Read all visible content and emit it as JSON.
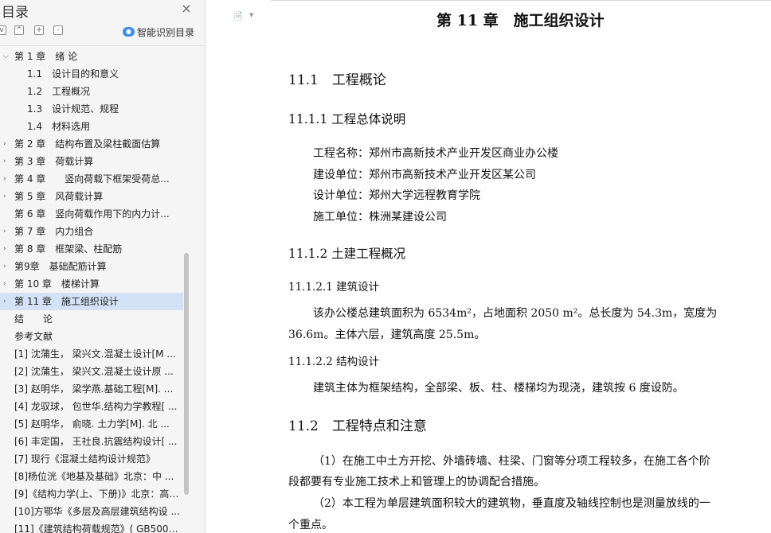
{
  "sidebar": {
    "title": "目录",
    "smart_toc_label": "智能识别目录",
    "tool_collapse": "-",
    "tool_up": "^",
    "tool_add": "+",
    "tool_check": "v",
    "close": "×",
    "items": [
      {
        "arrow": "v",
        "text": "第 1 章　绪  论",
        "level": 0
      },
      {
        "arrow": "",
        "text": "1.1　设计目的和意义",
        "level": 1
      },
      {
        "arrow": "",
        "text": "1.2　工程概况",
        "level": 1
      },
      {
        "arrow": "",
        "text": "1.3　设计规范、规程",
        "level": 1
      },
      {
        "arrow": "",
        "text": "1.4　材料选用",
        "level": 1
      },
      {
        "arrow": ">",
        "text": "第 2 章　结构布置及梁柱截面估算",
        "level": 0
      },
      {
        "arrow": ">",
        "text": "第 3 章　荷载计算",
        "level": 0
      },
      {
        "arrow": ">",
        "text": "第 4 章　　竖向荷载下框架受荷总...",
        "level": 0
      },
      {
        "arrow": ">",
        "text": "第 5 章　风荷载计算",
        "level": 0
      },
      {
        "arrow": "",
        "text": "第 6 章　竖向荷载作用下的内力计...",
        "level": 0
      },
      {
        "arrow": ">",
        "text": "第 7 章　内力组合",
        "level": 0
      },
      {
        "arrow": ">",
        "text": "第 8 章　框架梁、柱配筋",
        "level": 0
      },
      {
        "arrow": ">",
        "text": "第9章　基础配筋计算",
        "level": 0
      },
      {
        "arrow": ">",
        "text": "第 10 章　楼梯计算",
        "level": 0
      },
      {
        "arrow": ">",
        "text": "第 11 章　施工组织设计",
        "level": 0,
        "active": true
      },
      {
        "arrow": "",
        "text": "结　　论",
        "level": 0
      },
      {
        "arrow": "",
        "text": "参考文献",
        "level": 0
      },
      {
        "arrow": "",
        "text": "[1] 沈蒲生，  梁兴文.混凝土设计[M ...",
        "level": 0
      },
      {
        "arrow": "",
        "text": "[2] 沈蒲生，  梁兴文.混凝土设计原 ...",
        "level": 0
      },
      {
        "arrow": "",
        "text": "[3] 赵明华，  梁学燕.基础工程[M].  ...",
        "level": 0
      },
      {
        "arrow": "",
        "text": "[4] 龙驭球，  包世华.结构力学教程[ ...",
        "level": 0
      },
      {
        "arrow": "",
        "text": "[5] 赵明华，  俞晓. 土力学[M]. 北 ...",
        "level": 0
      },
      {
        "arrow": "",
        "text": "[6] 丰定国，  王社良.抗震结构设计[ ...",
        "level": 0
      },
      {
        "arrow": "",
        "text": "[7] 现行《混凝土结构设计规范》",
        "level": 0
      },
      {
        "arrow": "",
        "text": "[8]杨位洸《地基及基础》北京：中 ...",
        "level": 0
      },
      {
        "arrow": "",
        "text": "[9]《结构力学(上、下册)》北京：高 ...",
        "level": 0
      },
      {
        "arrow": "",
        "text": "[10]方鄂华《多层及高层建筑结构设 ...",
        "level": 0
      },
      {
        "arrow": "",
        "text": "[11]《建筑结构荷载规范》( GB500 ...",
        "level": 0
      }
    ]
  },
  "document": {
    "chapter_title": "第 11 章　施工组织设计",
    "s1": "11.1　工程概论",
    "s1_1": "11.1.1 工程总体说明",
    "info": [
      "工程名称：郑州市高新技术产业开发区商业办公楼",
      "建设单位：郑州市高新技术产业开发区某公司",
      "设计单位：郑州大学远程教育学院",
      "施工单位：株洲某建设公司"
    ],
    "s1_2": "11.1.2 土建工程概况",
    "s1_2_1": "11.1.2.1 建筑设计",
    "arch_p1": "该办公楼总建筑面积为 6534m²，占地面积 2050 m²。总长度为 54.3m，宽度为",
    "arch_p2": "36.6m。主体六层，建筑高度 25.5m。",
    "s1_2_2": "11.1.2.2 结构设计",
    "struct_p": "建筑主体为框架结构，全部梁、板、柱、楼梯均为现浇，建筑按 6 度设防。",
    "s2": "11.2　工程特点和注意",
    "feat1_a": "（1）在施工中土方开挖、外墙砖墙、柱梁、门窗等分项工程较多，在施工各个阶",
    "feat1_b": "段都要有专业施工技术上和管理上的协调配合措施。",
    "feat2_a": "（2）本工程为单层建筑面积较大的建筑物，垂直度及轴线控制也是测量放线的一",
    "feat2_b": "个重点。"
  }
}
